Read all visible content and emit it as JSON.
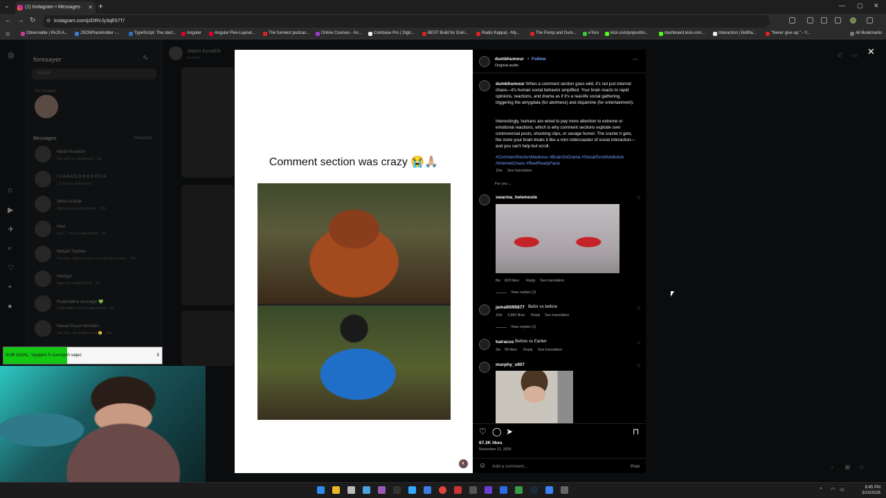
{
  "browser": {
    "tab_title": "(1) Instagram • Messages",
    "url": "instagram.com/p/DRVJy3qE57T/",
    "bookmarks": [
      "Observable | RxJS A...",
      "JSONPlaceholder -...",
      "TypeScript: The start...",
      "Angular",
      "Angular Flex-Layout...",
      "The funniest podcas...",
      "Online Courses - An...",
      "Coinbase Pro | Digit...",
      "BEST Build for Goin...",
      "Radio Kappa) - My...",
      "The Pump and Dum...",
      "eToro",
      "kick.com/popout/lo...",
      "dashboard.kick.com...",
      "Interaction | BotRa...",
      "\"Never give up.\" - Y..."
    ],
    "all_bookmarks": "All Bookmarks"
  },
  "dm": {
    "account": "foresayer",
    "search_placeholder": "Search",
    "note_text": "Your thoughts",
    "messages_label": "Messages",
    "requests_label": "Requests",
    "conversations": [
      {
        "name": "Martin Kovalčík",
        "preview": "You sent an attachment. · 3m"
      },
      {
        "name": "I V A N A S O R O K O V A",
        "preview": "I V sent an attachment."
      },
      {
        "name": "Viktor Krišťák",
        "preview": "Viktor sent an attachment. · 12h"
      },
      {
        "name": "Havi",
        "preview": "Havi ♡ sent an attachment. · 4d"
      },
      {
        "name": "Matyáš Topinka",
        "preview": "Čau chci, když už koupí na vy tak pac poslat... · 5w"
      },
      {
        "name": "Marllyyn",
        "preview": "https://ig.me/j/EKNRZK · 5w"
      },
      {
        "name": "Pudendálna neuralgie 💚",
        "preview": "Pudendálna sent an attachment. · 9w"
      },
      {
        "name": "Hawaii Royal Hermelín",
        "preview": "You: Bez vás nedám trend 😢 · 16w"
      }
    ],
    "chat_header_name": "Martin Kovalčík",
    "chat_header_sub": "kovalcik"
  },
  "post": {
    "caption_overlay": "Comment section was crazy 😭🙏🏼",
    "author": "dumbhumour",
    "follow_label": "Follow",
    "audio": "Original audio",
    "caption_p1": "When a comment section goes wild, it's not just internet chaos—it's human social behavior amplified. Your brain reacts to rapid opinions, reactions, and drama as if it's a real-life social gathering, triggering the amygdala (for alertness) and dopamine (for entertainment).",
    "caption_p2": "Interestingly, humans are wired to pay more attention to extreme or emotional reactions, which is why comment sections explode over controversial posts, shocking clips, or savage humor. The crazier it gets, the more your brain treats it like a mini rollercoaster of social interaction—and you can't help but scroll.",
    "hashtags": "#CommentSectionMadness #BrainOnDrama #SocialScrollAddiction #InternetChaos #ReelReadyFacts",
    "caption_meta": "15w",
    "see_translation": "See translation",
    "for_you": "For you ⌄",
    "comments": [
      {
        "user": "swarma_helemoole",
        "text": "",
        "age": "8w",
        "likes": "823 likes",
        "reply": "Reply",
        "translate": "See translation",
        "view_replies": "View replies (1)"
      },
      {
        "user": "jamal0095877",
        "text": "Befor vs before",
        "age": "10w",
        "likes": "3,983 likes",
        "reply": "Reply",
        "translate": "See translation",
        "view_replies": "View replies (1)"
      },
      {
        "user": "kairacus",
        "text": "Before vs Earlier",
        "age": "3w",
        "likes": "90 likes",
        "reply": "Reply",
        "translate": "See translation",
        "view_replies": ""
      },
      {
        "user": "murphy_s907",
        "text": "",
        "age": "",
        "likes": "",
        "reply": "",
        "translate": "",
        "view_replies": ""
      }
    ],
    "likes": "67.3K likes",
    "date": "November 21, 2025",
    "add_comment_placeholder": "Add a comment...",
    "post_label": "Post"
  },
  "stream": {
    "subgoal_label": "SUB GOAL: Vypijem 5 surových vajec",
    "subgoal_count": "5",
    "subgoal_progress": 0.4
  },
  "taskbar": {
    "time": "8:45 PM",
    "date": "3/10/2026"
  },
  "colors": {
    "link": "#6fa0ff",
    "progress": "#13c813"
  }
}
